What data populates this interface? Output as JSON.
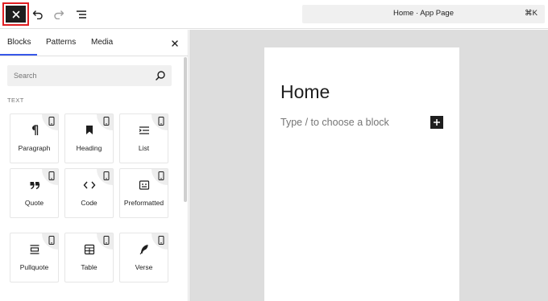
{
  "toolbar": {
    "close_icon": "close-icon",
    "undo_icon": "undo-icon",
    "redo_icon": "redo-icon",
    "list_view_icon": "list-view-icon",
    "document_title": "Home · App Page",
    "shortcut": "⌘K",
    "accent_color": "#e01e22"
  },
  "panel": {
    "tabs": [
      {
        "label": "Blocks",
        "active": true
      },
      {
        "label": "Patterns",
        "active": false
      },
      {
        "label": "Media",
        "active": false
      }
    ],
    "search_placeholder": "Search",
    "section_label": "TEXT",
    "blocks": [
      {
        "label": "Paragraph",
        "icon": "paragraph-icon"
      },
      {
        "label": "Heading",
        "icon": "heading-icon"
      },
      {
        "label": "List",
        "icon": "list-icon"
      },
      {
        "label": "Quote",
        "icon": "quote-icon"
      },
      {
        "label": "Code",
        "icon": "code-icon"
      },
      {
        "label": "Preformatted",
        "icon": "preformatted-icon"
      },
      {
        "label": "Pullquote",
        "icon": "pullquote-icon"
      },
      {
        "label": "Table",
        "icon": "table-icon"
      },
      {
        "label": "Verse",
        "icon": "verse-icon"
      }
    ],
    "tab_accent": "#3858e9"
  },
  "canvas": {
    "title": "Home",
    "placeholder": "Type / to choose a block"
  }
}
